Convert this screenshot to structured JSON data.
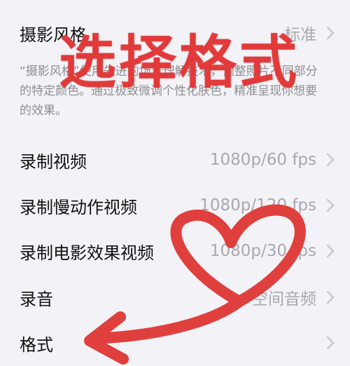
{
  "camera_settings": {
    "photographic_style": {
      "label": "摄影风格",
      "value": "标准"
    },
    "description": "“摄影风格”使用先进的场景理解技术，调整照片不同部分的特定颜色。通过极致微调个性化肤色，精准呈现你想要的效果。",
    "rows": [
      {
        "label": "录制视频",
        "value": "1080p/60 fps"
      },
      {
        "label": "录制慢动作视频",
        "value": "1080p/120 fps"
      },
      {
        "label": "录制电影效果视频",
        "value": "1080p/30 fps"
      },
      {
        "label": "录音",
        "value": "空间音频"
      },
      {
        "label": "格式",
        "value": ""
      }
    ]
  },
  "annotation": {
    "title": "选择格式",
    "color": "#e23a3a"
  }
}
